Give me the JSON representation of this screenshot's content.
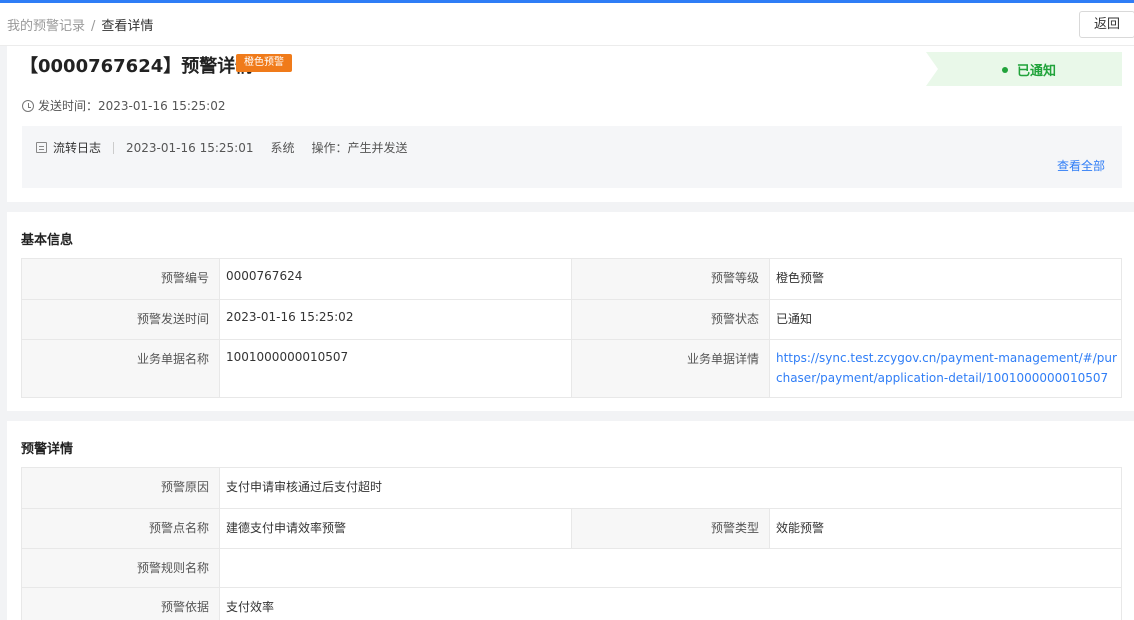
{
  "breadcrumb": {
    "parent": "我的预警记录",
    "separator": "/",
    "current": "查看详情"
  },
  "header": {
    "back_label": "返回"
  },
  "alert": {
    "title": "【0000767624】预警详情",
    "level_badge": "橙色预警",
    "status": "已通知",
    "send_time_label": "发送时间：",
    "send_time": "2023-01-16 15:25:02"
  },
  "log": {
    "title": "流转日志",
    "time": "2023-01-16 15:25:01",
    "actor": "系统",
    "action": "操作：产生并发送",
    "view_all": "查看全部"
  },
  "basic_info": {
    "title": "基本信息",
    "alert_no_label": "预警编号",
    "alert_no": "0000767624",
    "level_label": "预警等级",
    "level": "橙色预警",
    "send_time_label": "预警发送时间",
    "send_time": "2023-01-16 15:25:02",
    "status_label": "预警状态",
    "status": "已通知",
    "doc_name_label": "业务单据名称",
    "doc_name": "1001000000010507",
    "doc_detail_label": "业务单据详情",
    "doc_detail": "https://sync.test.zcygov.cn/payment-management/#/purchaser/payment/application-detail/1001000000010507"
  },
  "alert_detail": {
    "title": "预警详情",
    "reason_label": "预警原因",
    "reason": "支付申请审核通过后支付超时",
    "point_label": "预警点名称",
    "point": "建德支付申请效率预警",
    "type_label": "预警类型",
    "type": "效能预警",
    "rule_label": "预警规则名称",
    "rule": "",
    "basis_label": "预警依据",
    "basis": "支付效率"
  },
  "colors": {
    "accent": "#2f7df6",
    "badge_orange": "#f07b1a",
    "status_green": "#21a33b"
  },
  "icons": {
    "send_time": "clock-icon",
    "log": "log-icon"
  }
}
